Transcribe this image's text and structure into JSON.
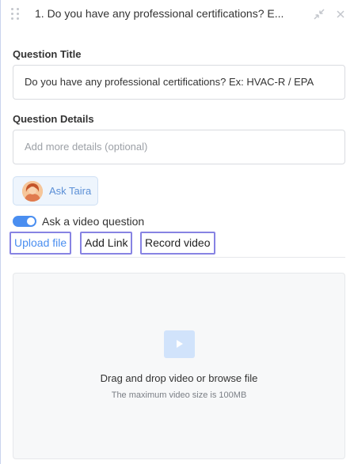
{
  "header": {
    "question": "1. Do you have any professional certifications? E..."
  },
  "form": {
    "title_label": "Question Title",
    "title_value": "Do you have any professional certifications? Ex: HVAC-R / EPA",
    "details_label": "Question Details",
    "details_placeholder": "Add more details (optional)"
  },
  "assistant": {
    "label": "Ask Taira"
  },
  "video": {
    "toggle_label": "Ask a video question",
    "toggle_on": true,
    "tabs": [
      "Upload file",
      "Add Link",
      "Record video"
    ],
    "active_tab": "Upload file"
  },
  "dropzone": {
    "title": "Drag and drop video or browse file",
    "subtitle": "The maximum video size is 100MB"
  },
  "colors": {
    "accent": "#4a8ef0",
    "tab_outline": "#8783e3",
    "assist_bg": "#eef5fd"
  }
}
